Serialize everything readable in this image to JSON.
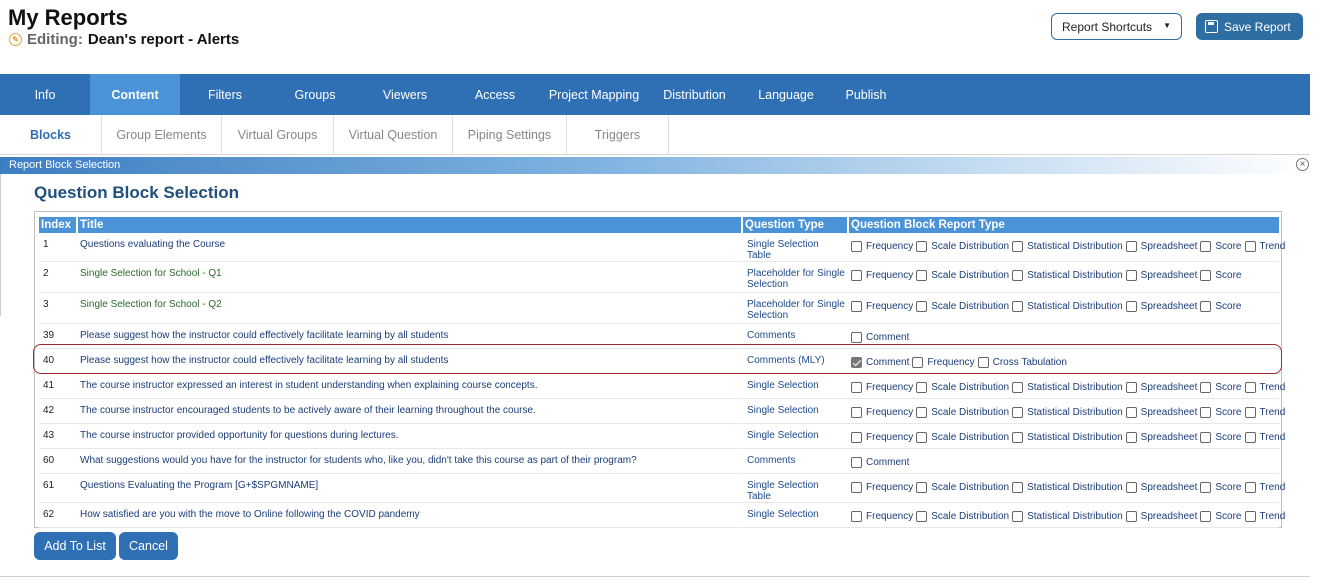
{
  "header": {
    "title": "My Reports",
    "editing_label": "Editing:",
    "editing_name": "Dean's report - Alerts",
    "shortcuts_label": "Report Shortcuts",
    "save_label": "Save Report"
  },
  "main_nav": [
    {
      "label": "Info",
      "active": false
    },
    {
      "label": "Content",
      "active": true
    },
    {
      "label": "Filters",
      "active": false
    },
    {
      "label": "Groups",
      "active": false
    },
    {
      "label": "Viewers",
      "active": false
    },
    {
      "label": "Access",
      "active": false
    },
    {
      "label": "Project Mapping",
      "active": false
    },
    {
      "label": "Distribution",
      "active": false
    },
    {
      "label": "Language",
      "active": false
    },
    {
      "label": "Publish",
      "active": false
    }
  ],
  "sub_nav": [
    {
      "label": "Blocks",
      "active": true
    },
    {
      "label": "Group Elements",
      "active": false
    },
    {
      "label": "Virtual Groups",
      "active": false
    },
    {
      "label": "Virtual Question",
      "active": false
    },
    {
      "label": "Piping Settings",
      "active": false
    },
    {
      "label": "Triggers",
      "active": false
    }
  ],
  "panel": {
    "bar_title": "Report Block Selection",
    "section_title": "Question Block Selection"
  },
  "table": {
    "headers": [
      "Index",
      "Title",
      "Question Type",
      "Question Block Report Type"
    ],
    "rows": [
      {
        "index": "1",
        "title": "Questions evaluating the Course",
        "type": "Single Selection Table",
        "title_color": "#1b3d78",
        "options": [
          {
            "label": "Frequency",
            "checked": false
          },
          {
            "label": "Scale Distribution",
            "checked": false
          },
          {
            "label": "Statistical Distribution",
            "checked": false
          },
          {
            "label": "Spreadsheet",
            "checked": false
          },
          {
            "label": "Score",
            "checked": false
          },
          {
            "label": "Trend",
            "checked": false
          }
        ]
      },
      {
        "index": "2",
        "title": "Single Selection for School - Q1",
        "type": "Placeholder for Single Selection",
        "title_color": "#2c6a2c",
        "options": [
          {
            "label": "Frequency",
            "checked": false
          },
          {
            "label": "Scale Distribution",
            "checked": false
          },
          {
            "label": "Statistical Distribution",
            "checked": false
          },
          {
            "label": "Spreadsheet",
            "checked": false
          },
          {
            "label": "Score",
            "checked": false
          }
        ]
      },
      {
        "index": "3",
        "title": "Single Selection for School - Q2",
        "type": "Placeholder for Single Selection",
        "title_color": "#2c6a2c",
        "options": [
          {
            "label": "Frequency",
            "checked": false
          },
          {
            "label": "Scale Distribution",
            "checked": false
          },
          {
            "label": "Statistical Distribution",
            "checked": false
          },
          {
            "label": "Spreadsheet",
            "checked": false
          },
          {
            "label": "Score",
            "checked": false
          }
        ]
      },
      {
        "index": "39",
        "title": "Please suggest how the instructor could effectively facilitate learning by all students",
        "type": "Comments",
        "title_color": "#1b3d78",
        "options": [
          {
            "label": "Comment",
            "checked": false
          }
        ]
      },
      {
        "index": "40",
        "title": "Please suggest how the instructor could effectively facilitate learning by all students",
        "type": "Comments (MLY)",
        "title_color": "#1b3d78",
        "options": [
          {
            "label": "Comment",
            "checked": true
          },
          {
            "label": "Frequency",
            "checked": false
          },
          {
            "label": "Cross Tabulation",
            "checked": false
          }
        ]
      },
      {
        "index": "41",
        "title": "The course instructor expressed an interest in student understanding when explaining course concepts.",
        "type": "Single Selection",
        "title_color": "#1b3d78",
        "options": [
          {
            "label": "Frequency",
            "checked": false
          },
          {
            "label": "Scale Distribution",
            "checked": false
          },
          {
            "label": "Statistical Distribution",
            "checked": false
          },
          {
            "label": "Spreadsheet",
            "checked": false
          },
          {
            "label": "Score",
            "checked": false
          },
          {
            "label": "Trend",
            "checked": false
          }
        ]
      },
      {
        "index": "42",
        "title": "The course instructor encouraged students to be actively aware of their learning throughout the course.",
        "type": "Single Selection",
        "title_color": "#1b3d78",
        "options": [
          {
            "label": "Frequency",
            "checked": false
          },
          {
            "label": "Scale Distribution",
            "checked": false
          },
          {
            "label": "Statistical Distribution",
            "checked": false
          },
          {
            "label": "Spreadsheet",
            "checked": false
          },
          {
            "label": "Score",
            "checked": false
          },
          {
            "label": "Trend",
            "checked": false
          }
        ]
      },
      {
        "index": "43",
        "title": "The course instructor provided opportunity for questions during lectures.",
        "type": "Single Selection",
        "title_color": "#1b3d78",
        "options": [
          {
            "label": "Frequency",
            "checked": false
          },
          {
            "label": "Scale Distribution",
            "checked": false
          },
          {
            "label": "Statistical Distribution",
            "checked": false
          },
          {
            "label": "Spreadsheet",
            "checked": false
          },
          {
            "label": "Score",
            "checked": false
          },
          {
            "label": "Trend",
            "checked": false
          }
        ]
      },
      {
        "index": "60",
        "title": "What suggestions would you have for the instructor for students who, like you, didn't take this course as part of their program?",
        "type": "Comments",
        "title_color": "#1b3d78",
        "options": [
          {
            "label": "Comment",
            "checked": false
          }
        ]
      },
      {
        "index": "61",
        "title": "Questions Evaluating the Program [G+$SPGMNAME]",
        "type": "Single Selection Table",
        "title_color": "#1b3d78",
        "options": [
          {
            "label": "Frequency",
            "checked": false
          },
          {
            "label": "Scale Distribution",
            "checked": false
          },
          {
            "label": "Statistical Distribution",
            "checked": false
          },
          {
            "label": "Spreadsheet",
            "checked": false
          },
          {
            "label": "Score",
            "checked": false
          },
          {
            "label": "Trend",
            "checked": false
          }
        ]
      },
      {
        "index": "62",
        "title": "How satisfied are you with the move to Online following the COVID pandemy",
        "type": "Single Selection",
        "title_color": "#1b3d78",
        "options": [
          {
            "label": "Frequency",
            "checked": false
          },
          {
            "label": "Scale Distribution",
            "checked": false
          },
          {
            "label": "Statistical Distribution",
            "checked": false
          },
          {
            "label": "Spreadsheet",
            "checked": false
          },
          {
            "label": "Score",
            "checked": false
          },
          {
            "label": "Trend",
            "checked": false
          }
        ]
      }
    ]
  },
  "actions": {
    "add_label": "Add To List",
    "cancel_label": "Cancel"
  },
  "colors": {
    "nav_bg": "#2f6fb4",
    "nav_active": "#4a93d7",
    "highlight": "#a12a2a"
  }
}
